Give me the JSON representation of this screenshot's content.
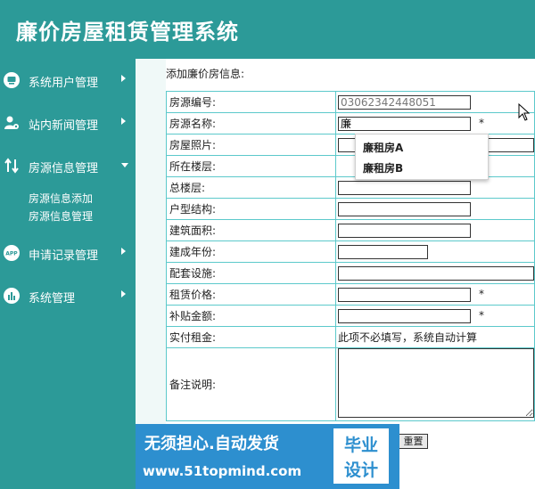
{
  "app": {
    "title": "廉价房屋租赁管理系统"
  },
  "sidebar": {
    "items": [
      {
        "label": "系统用户管理",
        "icon": "monitor-icon",
        "expanded": false
      },
      {
        "label": "站内新闻管理",
        "icon": "user-gear-icon",
        "expanded": false
      },
      {
        "label": "房源信息管理",
        "icon": "transfer-icon",
        "expanded": true,
        "children": [
          "房源信息添加",
          "房源信息管理"
        ]
      },
      {
        "label": "申请记录管理",
        "icon": "app-icon",
        "expanded": false
      },
      {
        "label": "系统管理",
        "icon": "bar-chart-icon",
        "expanded": false
      }
    ]
  },
  "form": {
    "title": "添加廉价房信息:",
    "fields": [
      {
        "label": "房源编号:",
        "value": "03062342448051"
      },
      {
        "label": "房源名称:",
        "value": "廉",
        "required": "*"
      },
      {
        "label": "房屋照片:"
      },
      {
        "label": "所在楼层:"
      },
      {
        "label": "总楼层:"
      },
      {
        "label": "户型结构:"
      },
      {
        "label": "建筑面积:"
      },
      {
        "label": "建成年份:"
      },
      {
        "label": "配套设施:"
      },
      {
        "label": "租赁价格:",
        "required": "*"
      },
      {
        "label": "补贴金额:",
        "required": "*"
      },
      {
        "label": "实付租金:",
        "note": "此项不必填写，系统自动计算"
      },
      {
        "label": "备注说明:"
      }
    ],
    "suggestions": [
      "廉租房A",
      "廉租房B"
    ],
    "reset_label": "重置"
  },
  "watermark": {
    "line1": "无须担心.自动发货",
    "line2": "www.51topmind.com",
    "badge1": "毕业",
    "badge2": "设计"
  },
  "colors": {
    "theme": "#2c9a98",
    "table_border": "#5cc9cb",
    "watermark_bg": "#2d8fcf"
  }
}
